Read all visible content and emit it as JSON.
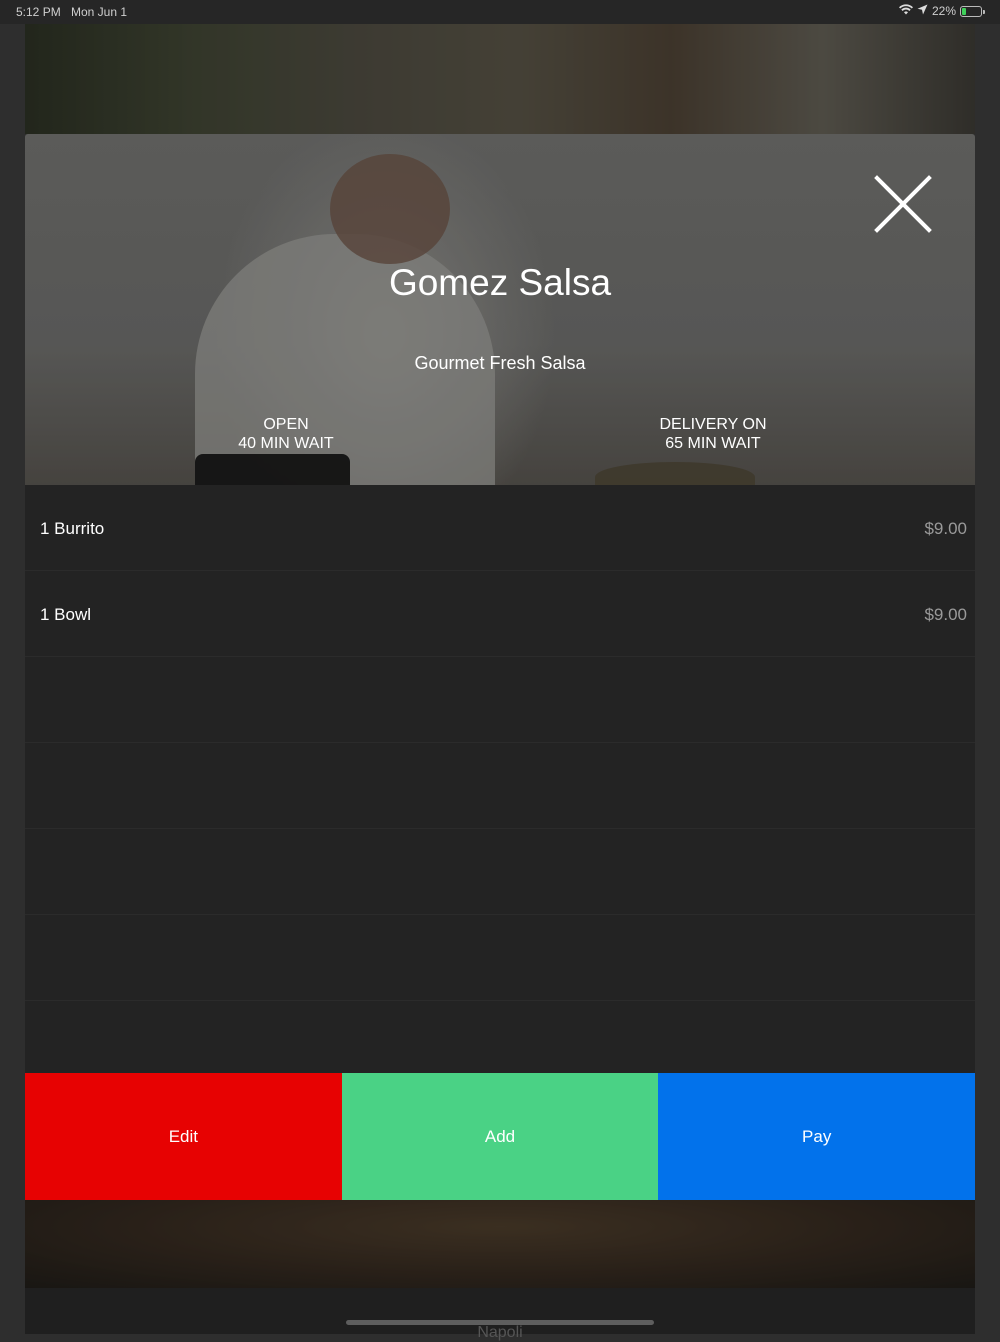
{
  "status_bar": {
    "time": "5:12 PM",
    "date": "Mon Jun 1",
    "battery": "22%",
    "battery_level": 0.22
  },
  "restaurant": {
    "name": "Gomez Salsa",
    "tagline": "Gourmet Fresh Salsa",
    "open_status": "OPEN",
    "open_wait": "40 MIN WAIT",
    "delivery_status": "DELIVERY ON",
    "delivery_wait": "65 MIN WAIT"
  },
  "order": {
    "items": [
      {
        "name": "1 Burrito",
        "price": "$9.00"
      },
      {
        "name": "1 Bowl",
        "price": "$9.00"
      }
    ]
  },
  "actions": {
    "edit_label": "Edit",
    "add_label": "Add",
    "pay_label": "Pay"
  },
  "background": {
    "next_card_label": "Napoli"
  },
  "colors": {
    "edit": "#e70202",
    "add": "#4ad285",
    "pay": "#0272eb",
    "modal_bg": "#232323"
  }
}
